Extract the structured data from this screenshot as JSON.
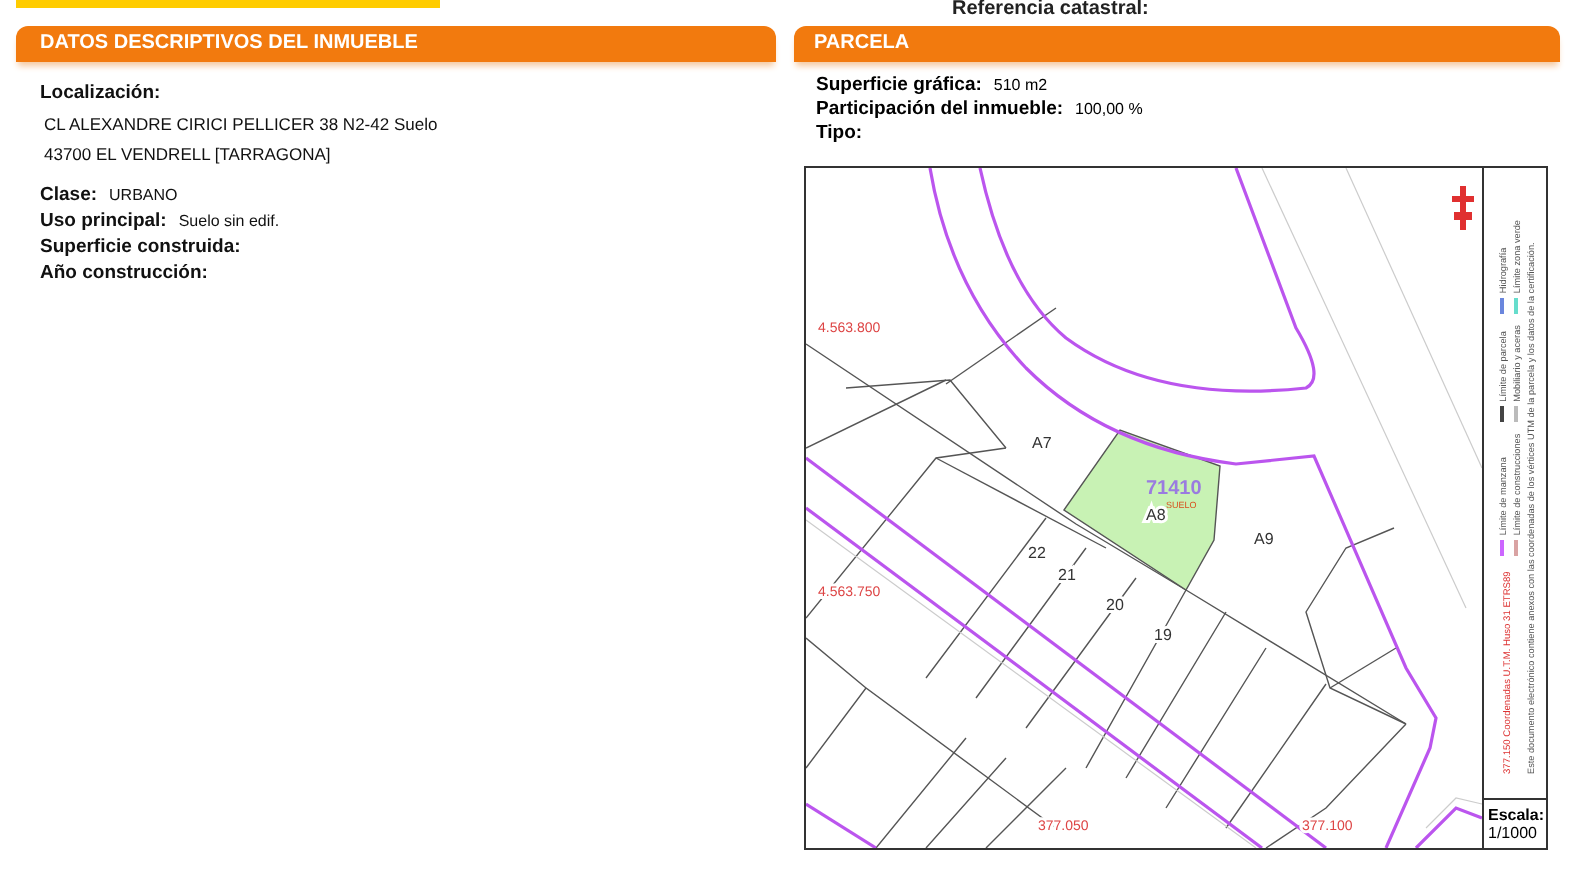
{
  "header": {
    "reference_label": "Referencia catastral:"
  },
  "inmueble": {
    "title": "DATOS DESCRIPTIVOS DEL **INMUEBLE**",
    "location_label": "Localización:",
    "location_lines": [
      "CL ALEXANDRE CIRICI PELLICER 38 N2-42 Suelo",
      "43700 EL VENDRELL [TARRAGONA]"
    ],
    "fields": [
      {
        "label": "Clase:",
        "value": "URBANO"
      },
      {
        "label": "Uso principal:",
        "value": "Suelo sin edif."
      },
      {
        "label": "Superficie construida:"
      },
      {
        "label": "Año construcción:"
      }
    ]
  },
  "parcela": {
    "title": "PARCELA",
    "fields": [
      {
        "label": "Superficie gráfica:",
        "value": "510 m2"
      },
      {
        "label": "Participación del inmueble:",
        "value": "100,00 %"
      },
      {
        "label": "Tipo:"
      }
    ],
    "map": {
      "labels": [
        {
          "text": "71410",
          "kind": "parcel"
        },
        {
          "text": "SUELO",
          "kind": "use"
        },
        {
          "text": "A7",
          "kind": "block"
        },
        {
          "text": "A8",
          "kind": "block"
        },
        {
          "text": "A9",
          "kind": "block"
        },
        {
          "text": "22",
          "kind": "block"
        },
        {
          "text": "21",
          "kind": "block"
        },
        {
          "text": "20",
          "kind": "block"
        },
        {
          "text": "19",
          "kind": "block"
        },
        {
          "text": "4.563.800",
          "kind": "coord"
        },
        {
          "text": "4.563.750",
          "kind": "coord"
        },
        {
          "text": "377.050",
          "kind": "coord"
        },
        {
          "text": "377.100",
          "kind": "coord"
        }
      ],
      "coordinates_note": "377.150 Coordenadas U.T.M. Huso 31 ETRS89",
      "legend": [
        {
          "label": "Límite de manzana",
          "color": "#cc66ff"
        },
        {
          "label": "Límite de construcciones",
          "color": "#d9a3a3"
        },
        {
          "label": "Límite de parcela",
          "color": "#444444"
        },
        {
          "label": "Mobiliario y aceras",
          "color": "#bbbbbb"
        },
        {
          "label": "Hidrografía",
          "color": "#6a86dd"
        },
        {
          "label": "Límite zona verde",
          "color": "#66ddcc"
        }
      ],
      "notice": "Este documento electrónico contiene anexos con las coordenadas de los vértices UTM de la parcela y los datos de la certificación.",
      "scale_label": "Escala:",
      "scale": "1/1000"
    }
  }
}
